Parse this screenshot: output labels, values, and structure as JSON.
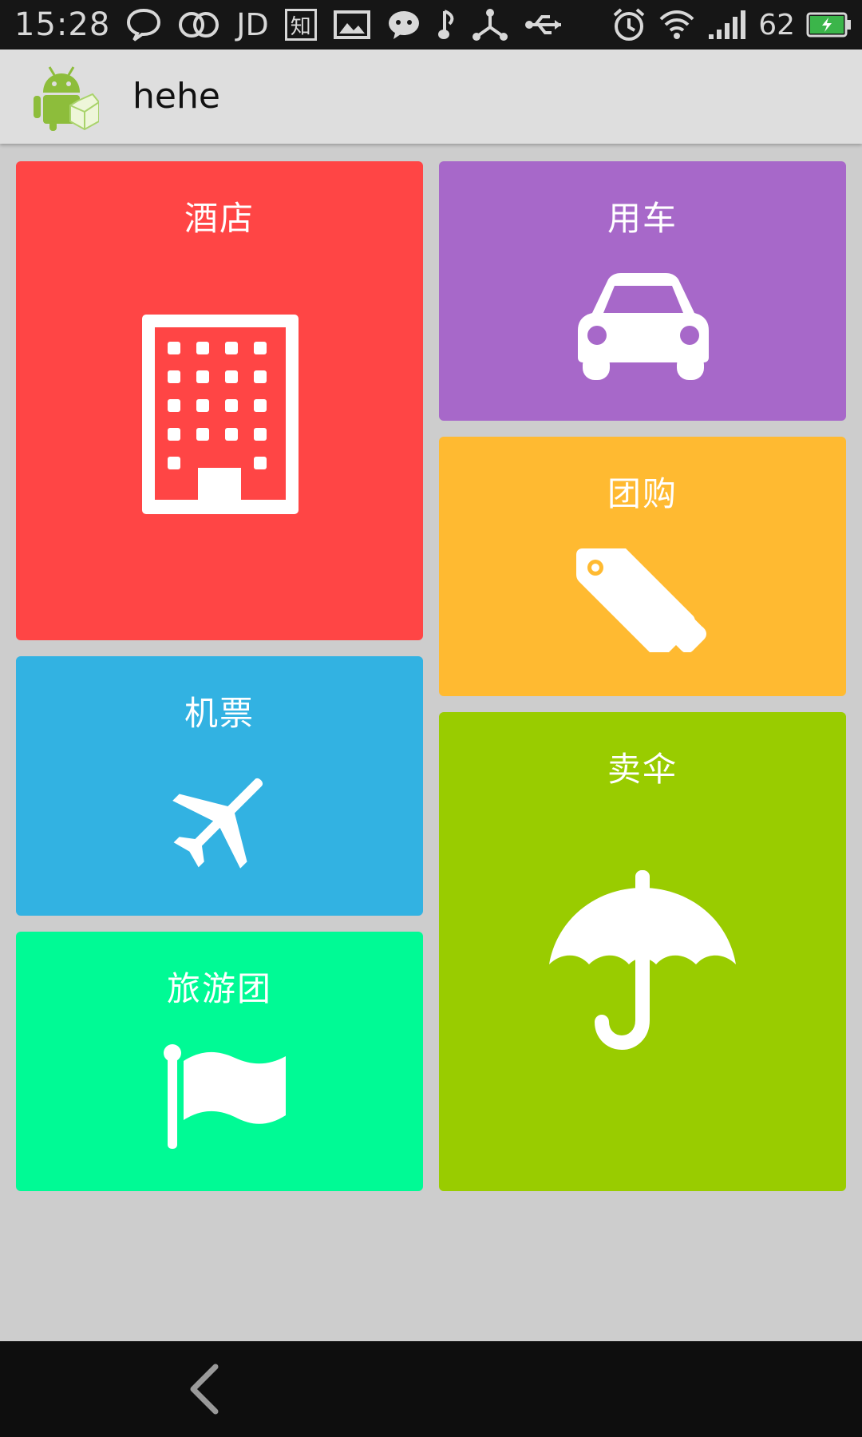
{
  "status_bar": {
    "time": "15:28",
    "jd_label": "JD",
    "zhi_label": "知",
    "battery_level": "62",
    "icons": [
      "chat-bubble-icon",
      "double-circle-icon",
      "jd-icon",
      "zhihu-icon",
      "image-icon",
      "wechat-icon",
      "music-icon",
      "share-icon",
      "usb-icon",
      "alarm-icon",
      "wifi-icon",
      "signal-icon",
      "battery-charging-icon"
    ]
  },
  "action_bar": {
    "title": "hehe"
  },
  "tiles": [
    {
      "label": "酒店",
      "icon": "hotel-building-icon",
      "color": "#ff4545"
    },
    {
      "label": "用车",
      "icon": "car-icon",
      "color": "#a768c9"
    },
    {
      "label": "团购",
      "icon": "tags-icon",
      "color": "#ffba31"
    },
    {
      "label": "机票",
      "icon": "airplane-icon",
      "color": "#32b2e2"
    },
    {
      "label": "旅游团",
      "icon": "flag-icon",
      "color": "#00fa95"
    },
    {
      "label": "卖伞",
      "icon": "umbrella-icon",
      "color": "#99cc00"
    }
  ],
  "nav_bar": {
    "back_icon": "back-chevron-icon"
  }
}
